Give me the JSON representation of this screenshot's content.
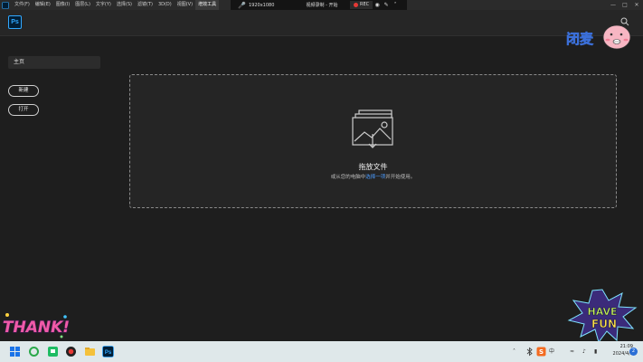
{
  "menubar": {
    "items": [
      "文件(F)",
      "编辑(E)",
      "图像(I)",
      "图层(L)",
      "文字(Y)",
      "选择(S)",
      "滤镜(T)",
      "3D(D)",
      "视图(V)",
      "增效工具"
    ]
  },
  "recorder": {
    "resolution": "1920x1080",
    "title": "视频录制 - 开始",
    "rec_label": "REC"
  },
  "app": {
    "logo_text": "Ps"
  },
  "sidebar": {
    "home_label": "主页",
    "new_button": "新建",
    "open_button": "打开"
  },
  "dropzone": {
    "title": "拖放文件",
    "subtitle_before": "或从您的电脑中",
    "subtitle_link": "选择一项",
    "subtitle_after": "并开始使用。"
  },
  "stickers": {
    "top_text": "闭麦",
    "thanks_text": "THANK!",
    "fun_line1": "HAVE",
    "fun_line2": "FUN"
  },
  "taskbar": {
    "ime_label": "中",
    "time": "21:09",
    "date": "2024/4/5",
    "notification_count": "2"
  },
  "colors": {
    "accent_blue": "#31a8ff",
    "link_blue": "#4b9cff",
    "rec_red": "#e53935"
  }
}
